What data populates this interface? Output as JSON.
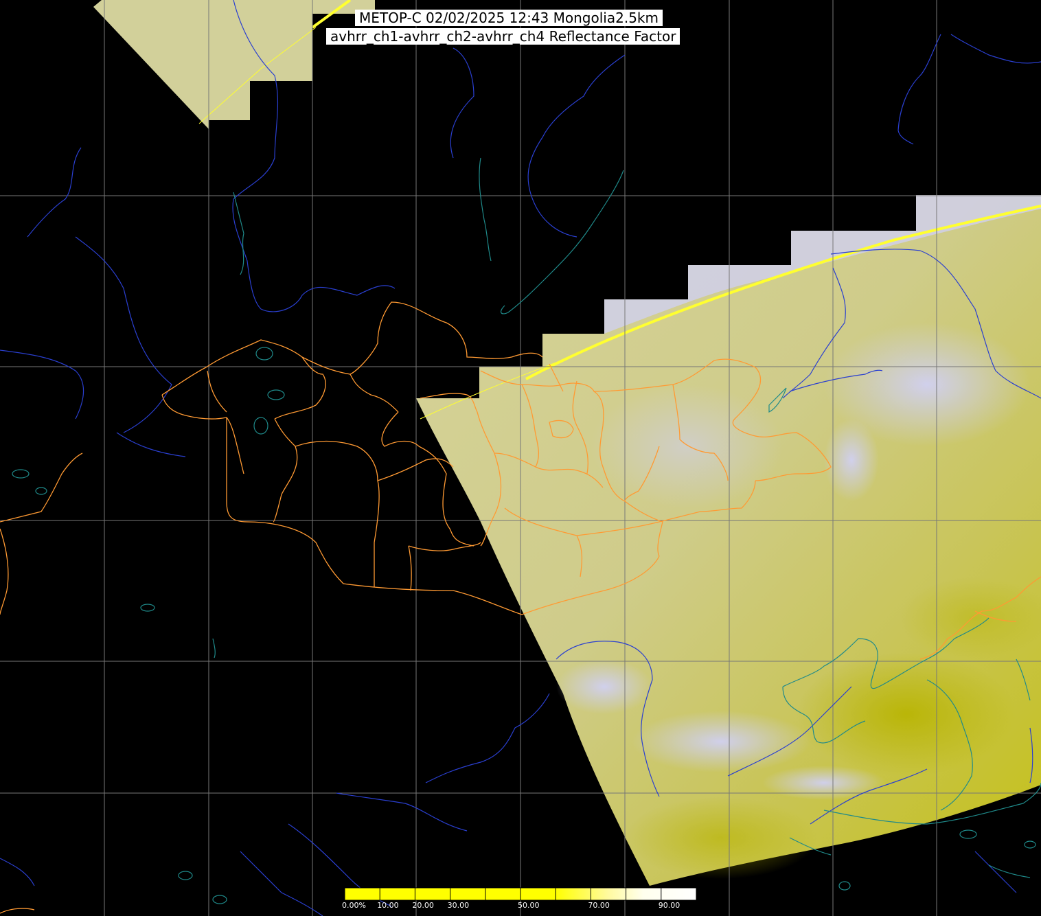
{
  "title": {
    "line1": "METOP-C 02/02/2025 12:43 Mongolia2.5km",
    "line2": "avhrr_ch1-avhrr_ch2-avhrr_ch4 Reflectance Factor"
  },
  "colors": {
    "background": "#000000",
    "grid": "#777777",
    "rivers": "#2a3fd0",
    "coastline": "#1f8a8a",
    "borders": "#ff9a33",
    "cloud_free_ground": "#c8c400",
    "clouds": "#c8c8ee",
    "orbit_edge": "#ffff30"
  },
  "colorbar": {
    "labels": [
      "0.00%",
      "10.00",
      "20.00",
      "30.00",
      "50.00",
      "70.00",
      "90.00"
    ],
    "label_values": [
      0,
      10,
      20,
      30,
      50,
      70,
      90
    ],
    "range": [
      0,
      100
    ],
    "stops": [
      {
        "value": 0,
        "color": "#ffff00"
      },
      {
        "value": 60,
        "color": "#ffff00"
      },
      {
        "value": 75,
        "color": "#fffaa0"
      },
      {
        "value": 85,
        "color": "#ffffee"
      },
      {
        "value": 100,
        "color": "#ffffff"
      }
    ]
  },
  "legend_items": [
    "rivers",
    "coastline",
    "borders"
  ]
}
